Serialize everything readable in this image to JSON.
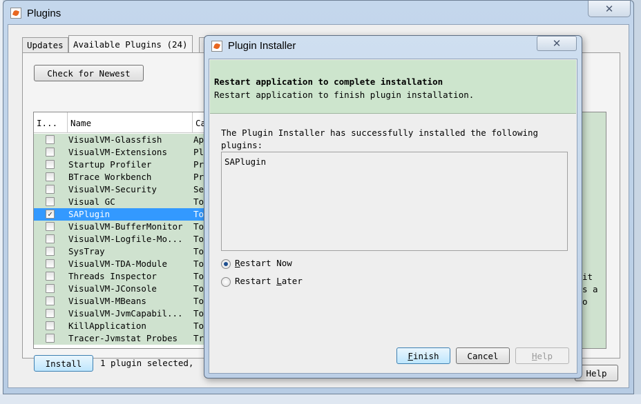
{
  "plugins_window": {
    "title": "Plugins",
    "close_glyph": "✕",
    "tabs": [
      {
        "label": "Updates",
        "active": false
      },
      {
        "label": "Available Plugins (24)",
        "active": true
      },
      {
        "label": "I",
        "active": false
      }
    ],
    "check_newest_label": "Check for Newest",
    "columns": [
      "I...",
      "Name",
      "Ca"
    ],
    "rows": [
      {
        "checked": false,
        "name": "VisualVM-Glassfish",
        "category": "Ap"
      },
      {
        "checked": false,
        "name": "VisualVM-Extensions",
        "category": "Pl"
      },
      {
        "checked": false,
        "name": "Startup Profiler",
        "category": "Pr"
      },
      {
        "checked": false,
        "name": "BTrace Workbench",
        "category": "Pr"
      },
      {
        "checked": false,
        "name": "VisualVM-Security",
        "category": "Se"
      },
      {
        "checked": false,
        "name": "Visual GC",
        "category": "To"
      },
      {
        "checked": true,
        "name": "SAPlugin",
        "category": "To",
        "selected": true
      },
      {
        "checked": false,
        "name": "VisualVM-BufferMonitor",
        "category": "To"
      },
      {
        "checked": false,
        "name": "VisualVM-Logfile-Mo...",
        "category": "To"
      },
      {
        "checked": false,
        "name": "SysTray",
        "category": "To"
      },
      {
        "checked": false,
        "name": "VisualVM-TDA-Module",
        "category": "To"
      },
      {
        "checked": false,
        "name": "Threads Inspector",
        "category": "To"
      },
      {
        "checked": false,
        "name": "VisualVM-JConsole",
        "category": "To"
      },
      {
        "checked": false,
        "name": "VisualVM-MBeans",
        "category": "To"
      },
      {
        "checked": false,
        "name": "VisualVM-JvmCapabil...",
        "category": "To"
      },
      {
        "checked": false,
        "name": "KillApplication",
        "category": "To"
      },
      {
        "checked": false,
        "name": "Tracer-Jvmstat Probes",
        "category": "Tr"
      }
    ],
    "right_pane_fragments": [
      "it",
      "s a",
      "o"
    ],
    "install_label": "Install",
    "selection_status": "1 plugin selected,",
    "help_label": "Help"
  },
  "installer_dialog": {
    "title": "Plugin Installer",
    "close_glyph": "✕",
    "header_title": "Restart application to complete installation",
    "header_subtitle": "Restart application to finish plugin installation.",
    "message_line1": "The Plugin Installer has successfully installed the following",
    "message_line2": "plugins:",
    "installed_plugins": "SAPlugin",
    "restart_now": {
      "prefix": "",
      "mnemonic": "R",
      "rest": "estart Now",
      "selected": true
    },
    "restart_later": {
      "prefix": "Restart ",
      "mnemonic": "L",
      "rest": "ater",
      "selected": false
    },
    "finish": {
      "mnemonic": "F",
      "rest": "inish"
    },
    "cancel_label": "Cancel",
    "help": {
      "mnemonic": "H",
      "rest": "elp"
    }
  },
  "colors": {
    "highlight": "#3399ff",
    "row_green": "#cfe2cf",
    "header_green": "#cde5cd"
  }
}
